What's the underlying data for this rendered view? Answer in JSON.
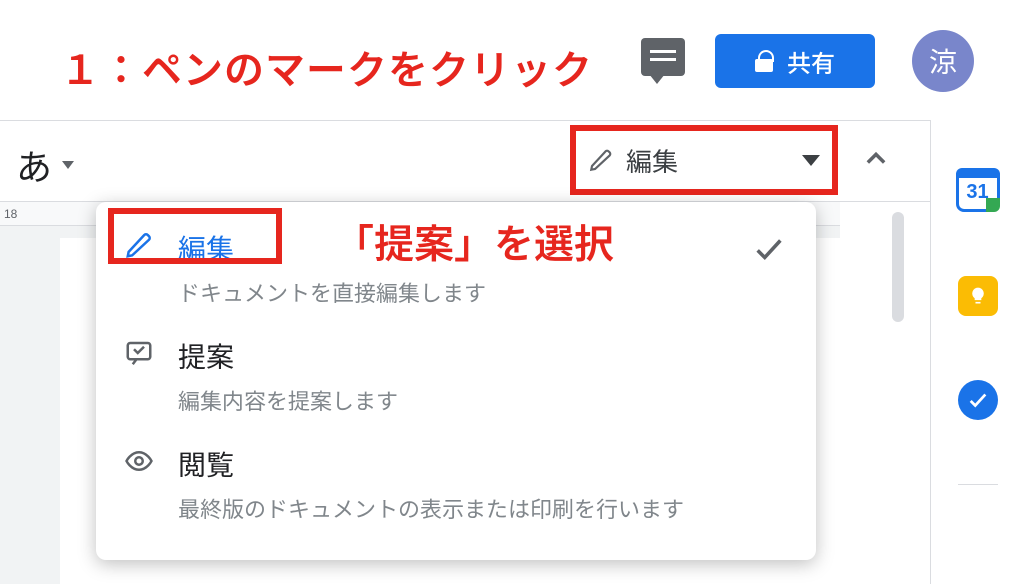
{
  "annotations": {
    "step1": "１：ペンのマークをクリック",
    "step2": "「提案」を選択"
  },
  "header": {
    "share_label": "共有",
    "avatar_letter": "涼"
  },
  "toolbar": {
    "ime": "あ",
    "mode_selected": "編集"
  },
  "ruler_snippet": "18",
  "dropdown": {
    "items": [
      {
        "title": "編集",
        "desc": "ドキュメントを直接編集します",
        "icon": "pencil",
        "checked": true
      },
      {
        "title": "提案",
        "desc": "編集内容を提案します",
        "icon": "suggest",
        "checked": false
      },
      {
        "title": "閲覧",
        "desc": "最終版のドキュメントの表示または印刷を行います",
        "icon": "eye",
        "checked": false
      }
    ]
  },
  "side": {
    "calendar_day": "31"
  }
}
